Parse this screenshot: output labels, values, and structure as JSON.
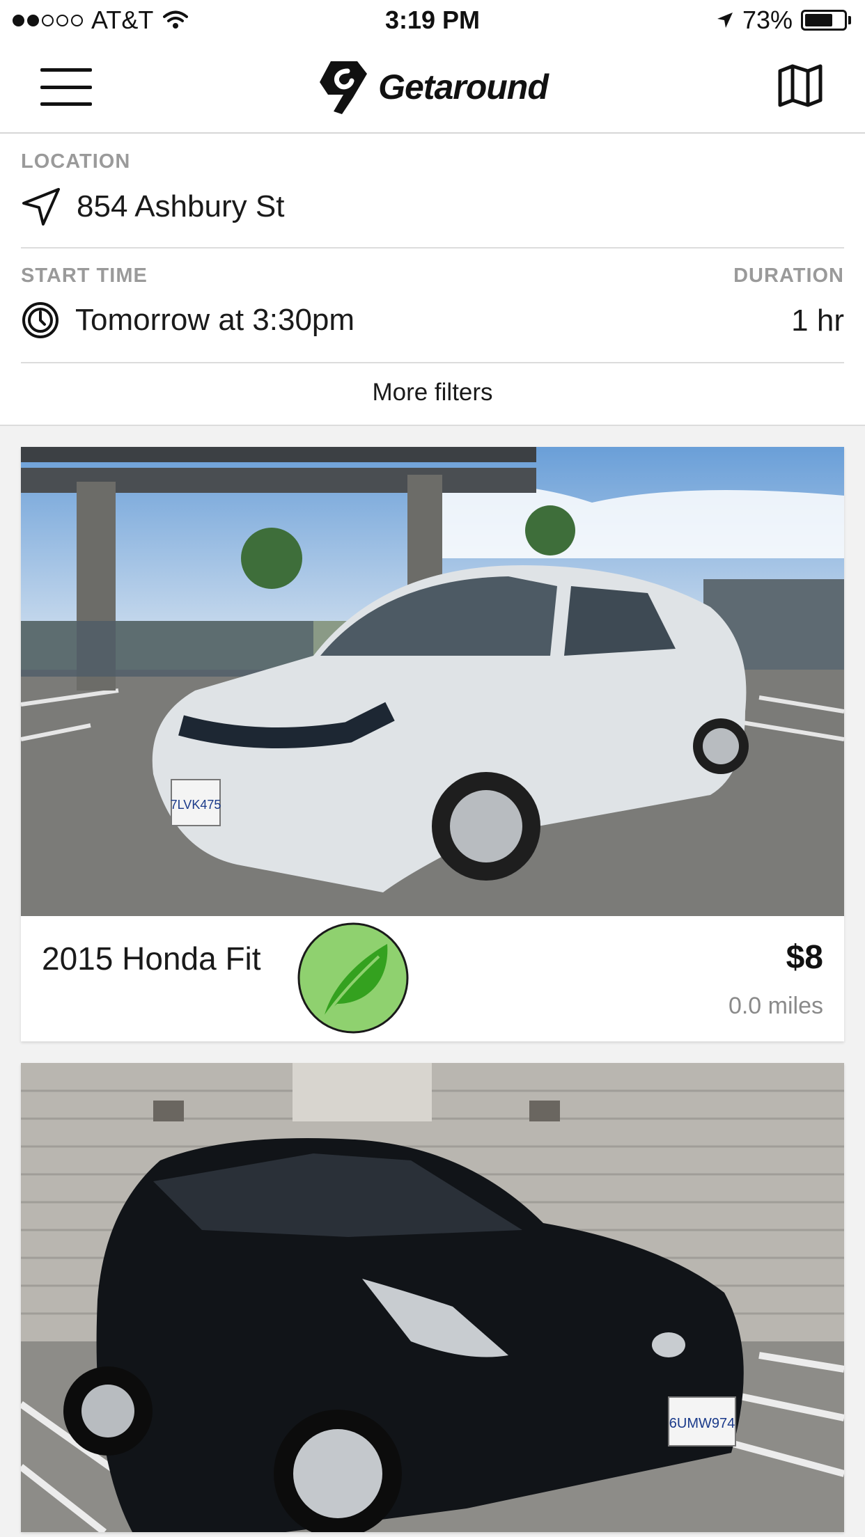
{
  "status_bar": {
    "carrier": "AT&T",
    "time": "3:19 PM",
    "battery": "73%",
    "battery_level": 0.73,
    "signal_bars": 2,
    "signal_total": 5
  },
  "nav": {
    "brand": "Getaround",
    "menu_icon": "hamburger-icon",
    "map_icon": "map-icon"
  },
  "filters": {
    "location_label": "LOCATION",
    "location_value": "854 Ashbury St",
    "start_time_label": "START TIME",
    "start_time_value": "Tomorrow at 3:30pm",
    "duration_label": "DURATION",
    "duration_value": "1 hr",
    "more_filters": "More filters"
  },
  "listings": [
    {
      "name": "2015 Honda Fit",
      "price": "$8",
      "distance": "0.0 miles",
      "eco_badge": true,
      "car_color": "#dfe3e6",
      "plate": "7LVK475"
    },
    {
      "name": "",
      "car_color": "#111418",
      "plate": "6UMW974"
    }
  ],
  "colors": {
    "eco_green": "#8fd16f",
    "leaf_green": "#34a11f",
    "label_gray": "#9a9a9a"
  }
}
